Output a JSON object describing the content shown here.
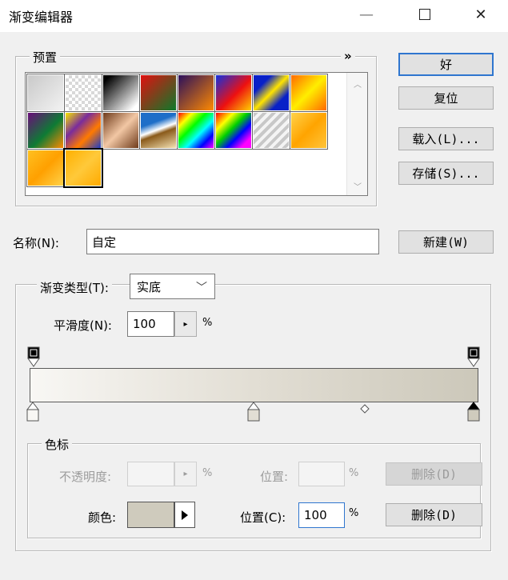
{
  "window": {
    "title": "渐变编辑器",
    "minimize_glyph": "—",
    "close_glyph": "✕"
  },
  "buttons": {
    "ok": "好",
    "reset": "复位",
    "load": "载入(L)...",
    "save": "存储(S)...",
    "new": "新建(W)"
  },
  "presets": {
    "title": "预置",
    "flyout": "»",
    "swatches": [
      {
        "name": "foreground-to-background",
        "css": "linear-gradient(135deg,#c9c9c9,#f2f2f2)"
      },
      {
        "name": "foreground-to-transparent",
        "css": "repeating-conic-gradient(#d8d8d8 0% 25%, #fff 0% 50%) 0 0/8px 8px"
      },
      {
        "name": "black-white",
        "css": "linear-gradient(135deg,#000 10%,#fff 90%)"
      },
      {
        "name": "red-green",
        "css": "linear-gradient(135deg,#e01010,#0c7a2a)"
      },
      {
        "name": "violet-orange",
        "css": "linear-gradient(135deg,#2a0f5c,#ff8a00)"
      },
      {
        "name": "blue-red-yellow",
        "css": "linear-gradient(135deg,#1030e0,#ee1010 55%,#ffd200)"
      },
      {
        "name": "blue-yellow-blue",
        "css": "linear-gradient(135deg,#0820c8 25%,#ffe400 50%,#0820c8 75%)"
      },
      {
        "name": "orange-yellow-orange",
        "css": "linear-gradient(135deg,#ff6a00,#ffee00 50%,#ff6a00)"
      },
      {
        "name": "violet-green-orange",
        "css": "linear-gradient(135deg,#6a0d7a,#0e7b34 55%,#ff8a00)"
      },
      {
        "name": "yellow-violet-orange-blue",
        "css": "linear-gradient(135deg,#f7e600,#7a2c9c 35%,#ff7a00 65%,#1c3cc8)"
      },
      {
        "name": "copper",
        "css": "linear-gradient(135deg,#6e3a1a,#f2c7a4 50%,#6e3a1a)"
      },
      {
        "name": "chrome",
        "css": "linear-gradient(160deg,#1e6ec8 30%,#fff 48%,#8a5a1a 58%,#f4e2b4)"
      },
      {
        "name": "spectrum",
        "css": "linear-gradient(135deg,#ff0000,#ffff00 20%,#00ff00 40%,#00ffff 60%,#0000ff 80%,#ff00ff)"
      },
      {
        "name": "transparent-rainbow",
        "css": "linear-gradient(135deg,#ff0000,#ffff00 25%,#00d000 45%,#0000ff 65%,#ff00ff 85%)"
      },
      {
        "name": "transparent-stripes",
        "css": "repeating-linear-gradient(135deg,#c8c8c8 0 4px,#f4f4f4 4px 8px)"
      },
      {
        "name": "custom-orange-1",
        "css": "linear-gradient(135deg,#ffd24a,#ffa400 50%,#ffc43a)"
      },
      {
        "name": "custom-orange-2",
        "css": "linear-gradient(135deg,#ffc020,#ffa000 50%,#ffd24a)"
      },
      {
        "name": "custom-orange-3",
        "css": "linear-gradient(135deg,#ffb000,#ffc93a 50%,#ffaa00)"
      }
    ]
  },
  "name_field": {
    "label": "名称(N):",
    "value": "自定"
  },
  "gradient": {
    "type_label": "渐变类型(T):",
    "type_value": "实底",
    "smooth_label": "平滑度(N):",
    "smooth_value": "100",
    "smooth_unit": "%",
    "spin_glyph": "▸"
  },
  "color_stops": {
    "title": "色标",
    "opacity_label": "不透明度:",
    "opacity_unit": "%",
    "opacity_location_label": "位置:",
    "opacity_location_unit": "%",
    "delete_disabled": "删除(D)",
    "color_label": "颜色:",
    "color_value": "#cfcbbd",
    "location_label": "位置(C):",
    "location_value": "100",
    "location_unit": "%",
    "delete": "删除(D)"
  }
}
